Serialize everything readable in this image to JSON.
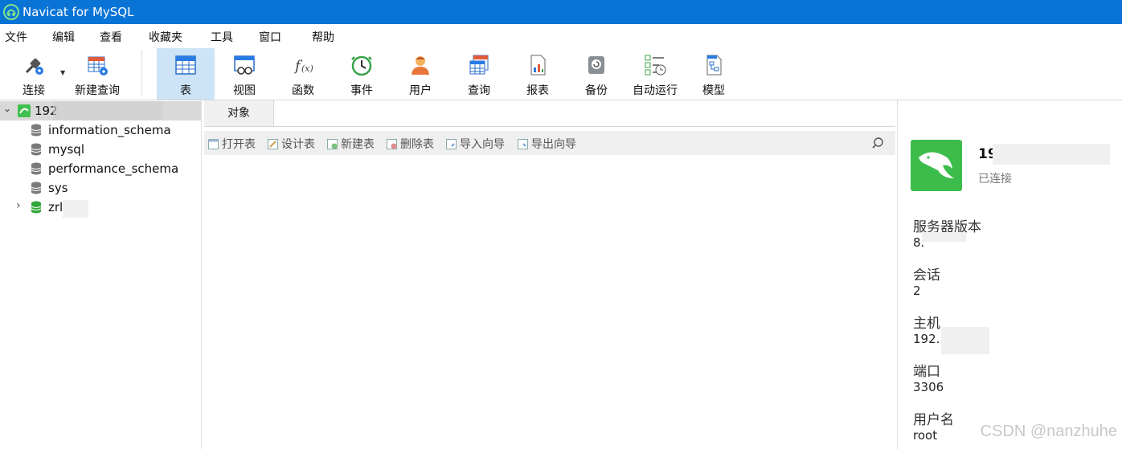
{
  "window": {
    "title": "Navicat for MySQL",
    "accent": "#0a74d6"
  },
  "menu": [
    "文件",
    "编辑",
    "查看",
    "收藏夹",
    "工具",
    "窗口",
    "帮助"
  ],
  "toolbar": {
    "items": [
      {
        "label": "连接",
        "icon": "plug-icon"
      },
      {
        "label": "新建查询",
        "icon": "new-query-icon"
      },
      {
        "label": "表",
        "icon": "table-icon",
        "active": true
      },
      {
        "label": "视图",
        "icon": "view-icon"
      },
      {
        "label": "函数",
        "icon": "function-icon"
      },
      {
        "label": "事件",
        "icon": "clock-icon"
      },
      {
        "label": "用户",
        "icon": "user-icon"
      },
      {
        "label": "查询",
        "icon": "query-icon"
      },
      {
        "label": "报表",
        "icon": "report-icon"
      },
      {
        "label": "备份",
        "icon": "backup-icon"
      },
      {
        "label": "自动运行",
        "icon": "schedule-icon"
      },
      {
        "label": "模型",
        "icon": "model-icon"
      }
    ]
  },
  "sidebar": {
    "connection": "192",
    "databases": [
      {
        "name": "information_schema",
        "open": false
      },
      {
        "name": "mysql",
        "open": false
      },
      {
        "name": "performance_schema",
        "open": false
      },
      {
        "name": "sys",
        "open": false
      },
      {
        "name": "zrl",
        "open": true
      }
    ]
  },
  "center": {
    "tab": "对象",
    "actions": [
      "打开表",
      "设计表",
      "新建表",
      "删除表",
      "导入向导",
      "导出向导"
    ]
  },
  "info": {
    "name": "19",
    "status": "已连接",
    "server_version_label": "服务器版本",
    "server_version": "8.",
    "session_label": "会话",
    "session": "2",
    "host_label": "主机",
    "host": "192.",
    "port_label": "端口",
    "port": "3306",
    "user_label": "用户名",
    "user": "root"
  },
  "watermark": "CSDN @nanzhuhe"
}
